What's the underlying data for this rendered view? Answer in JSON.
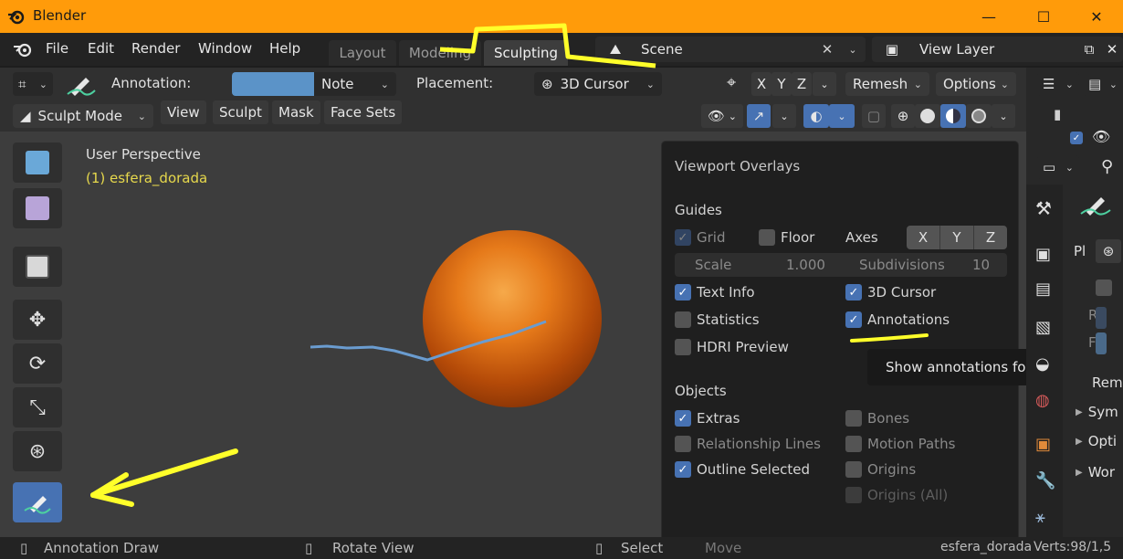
{
  "window": {
    "title": "Blender",
    "controls": {
      "minimize": "—",
      "maximize": "☐",
      "close": "✕"
    }
  },
  "menu": {
    "items": [
      "File",
      "Edit",
      "Render",
      "Window",
      "Help"
    ]
  },
  "workspace_tabs": [
    {
      "label": "Layout",
      "active": false
    },
    {
      "label": "Modeling",
      "active": false
    },
    {
      "label": "Sculpting",
      "active": true
    }
  ],
  "scene": {
    "value": "Scene",
    "clear": "✕"
  },
  "view_layer": {
    "value": "View Layer"
  },
  "tool_header": {
    "annotation_label": "Annotation:",
    "annotation_color": "#5b93c8",
    "note_value": "Note",
    "placement_label": "Placement:",
    "placement_value": "3D Cursor",
    "axes": [
      "X",
      "Y",
      "Z"
    ],
    "remesh": "Remesh",
    "options": "Options"
  },
  "mode_row": {
    "mode": "Sculpt Mode",
    "menus": [
      "View",
      "Sculpt",
      "Mask",
      "Face Sets"
    ]
  },
  "viewport": {
    "perspective": "User Perspective",
    "object": "(1) esfera_dorada"
  },
  "overlays": {
    "title": "Viewport Overlays",
    "guides": {
      "heading": "Guides",
      "grid": "Grid",
      "floor": "Floor",
      "axes_label": "Axes",
      "axes": [
        "X",
        "Y",
        "Z"
      ],
      "scale_label": "Scale",
      "scale_value": "1.000",
      "subdivisions_label": "Subdivisions",
      "subdivisions_value": "10",
      "text_info": "Text Info",
      "cursor_3d": "3D Cursor",
      "statistics": "Statistics",
      "annotations": "Annotations",
      "hdri": "HDRI Preview"
    },
    "objects": {
      "heading": "Objects",
      "extras": "Extras",
      "bones": "Bones",
      "relationship_lines": "Relationship Lines",
      "motion_paths": "Motion Paths",
      "outline_selected": "Outline Selected",
      "origins": "Origins",
      "origins_all": "Origins (All)"
    }
  },
  "tooltip": "Show annotations for this view.",
  "right_panel": {
    "pl": "Pl",
    "r": "R",
    "f": "F",
    "rem": "Rem",
    "sym": "Sym",
    "opti": "Opti",
    "wor": "Wor"
  },
  "statusbar": {
    "annotation_draw": "Annotation Draw",
    "rotate_view": "Rotate View",
    "select": "Select",
    "move": "Move",
    "object_name": "esfera_dorada",
    "verts": "Verts:98/1,5"
  },
  "colors": {
    "title_bar": "#ff9b0a",
    "accent_blue": "#4772b3",
    "highlight_yellow": "#ffff2a",
    "annotation_line": "#6a9cd0"
  }
}
